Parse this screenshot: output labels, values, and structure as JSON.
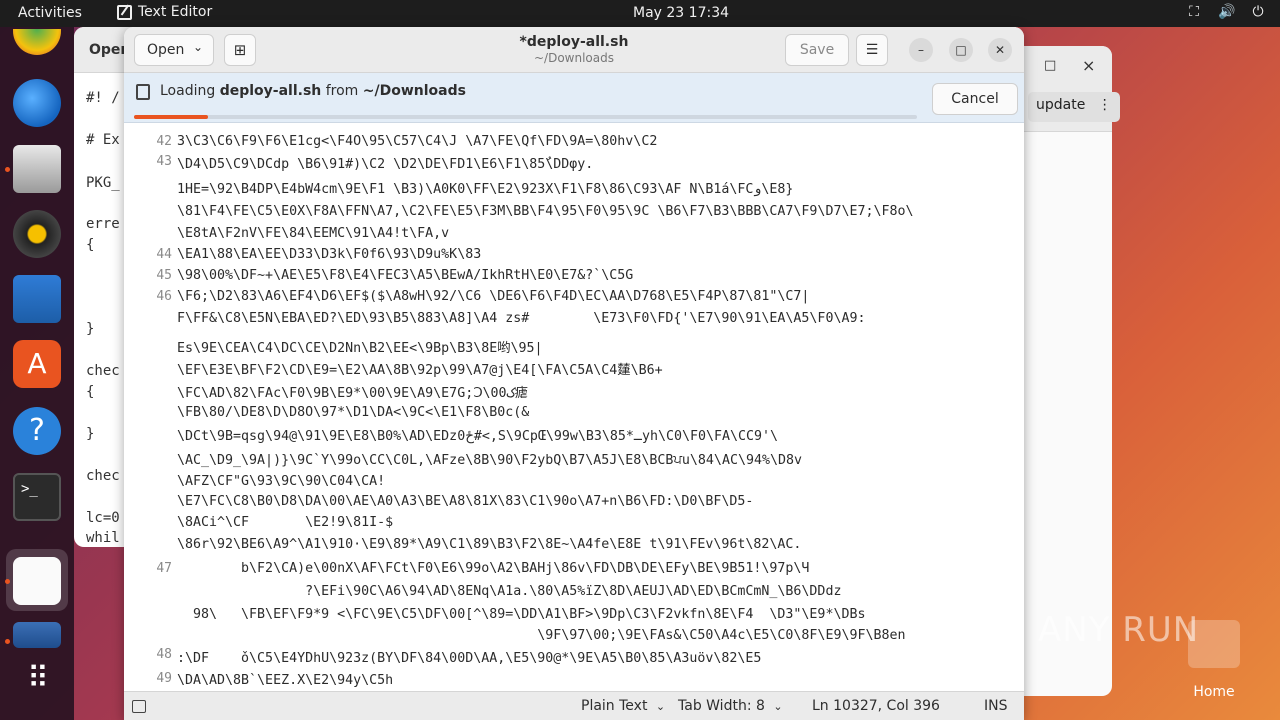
{
  "topbar": {
    "activities": "Activities",
    "app_name": "Text Editor",
    "clock": "May 23  17:34"
  },
  "bg_window": {
    "header": "Open",
    "lines": [
      "#! /",
      "# Ex",
      "PKG_",
      "erre",
      "{",
      "}",
      "chec",
      "{",
      "}",
      "chec",
      "lc=0",
      "whil"
    ]
  },
  "right_window": {
    "update_label": "update",
    "maximize": "□",
    "close": "×"
  },
  "editor": {
    "open_label": "Open",
    "save_label": "Save",
    "title": "*deploy-all.sh",
    "subtitle": "~/Downloads",
    "loading_prefix": "Loading",
    "loading_file": "deploy-all.sh",
    "loading_from": "from",
    "loading_dir": "~/Downloads",
    "cancel_label": "Cancel",
    "progress": 0.095
  },
  "code": {
    "line_numbers": [
      "42",
      "43",
      "44",
      "45",
      "46",
      "47",
      "48",
      "49"
    ],
    "lines": [
      "3\\C3\\C6\\F9\\F6\\E1cg<\\F4O\\95\\C57\\C4\\J \\A7\\FE\\Qf\\FD\\9A=\\80hv\\C2",
      "\\D4\\D5\\C9\\DCdp \\B6\\91#)\\C2 \\D2\\DE\\FD1\\E6\\F1\\85ُ\\DDφy.",
      "1HE=\\92\\B4DP\\E4bW4cm\\9E\\F1 \\B3)\\A0K0\\FF\\E2\\923X\\F1\\F8\\86\\C93\\AF N\\B1á\\FCو\\E8}",
      "\\81\\F4\\FE\\C5\\E0X\\F8A\\FFN\\A7,\\C2\\FE\\E5\\F3M\\BB\\F4\\95\\F0\\95\\9C \\B6\\F7\\B3\\BBB\\CA7\\F9\\D7\\E7;\\F8o\\",
      "\\E8tA\\F2nV\\FE\\84\\EEMC\\91\\A4!t\\FA,v",
      "\\EA1\\88\\EA\\EE\\D33\\D3k\\F0f6\\93\\D9u%K\\83",
      "\\98\\00%\\DF~+\\AE\\E5\\F8\\E4\\FEC3\\A5\\BEwA/IkhRtH\\E0\\E7&?`\\C5G",
      "\\F6;\\D2\\83\\A6\\EF4\\D6\\EF$($\\A8wH\\92/\\C6 \\DE6\\F6\\F4D\\EC\\AA\\D768\\E5\\F4P\\87\\81\"\\C7|",
      "F\\FF&\\C8\\E5N\\EBA\\ED?\\ED\\93\\B5\\883\\A8]\\A4 zs#        \\E73\\F0\\FD{'\\E7\\90\\91\\EA\\A5\\F0\\A9:",
      "Es\\9E\\CEA\\C4\\DC\\CE\\D2Nn\\B2\\EE<\\9Bp\\B3\\8E哟\\95|",
      "\\EF\\E3E\\BF\\F2\\CD\\E9=\\E2\\AA\\8B\\92p\\99\\A7@j\\E4[\\FA\\C5A\\C4㯬\\B6+",
      "\\FC\\AD\\82\\FAc\\F0\\9B\\E9*\\00\\9E\\A9\\E7G;Ↄ\\00ک瘧",
      "\\FB\\80/\\DE8\\D\\D8O\\97*\\D1\\DA<\\9C<\\E1\\F8\\B0c(&",
      "\\DCt\\9B=qsg\\94@\\91\\9E\\E8\\B0%\\AD\\EDzځ0#<,S\\9CpŒ\\99w\\B3\\85*ـyh\\C0\\F0\\FA\\CC9'\\",
      "\\AC_\\D9_\\9A|)}\\9C`Y\\99o\\CC\\C0L,\\AFze\\8B\\90\\F2ybQ\\B7\\A5J\\E8\\BCBਪu\\84\\AC\\94%\\D8v",
      "\\AFZ\\CF\"G\\93\\9C\\90\\C04\\CA!",
      "\\E7\\FC\\C8\\B0\\D8\\DA\\00\\AE\\A0\\A3\\BE\\A8\\81X\\83\\C1\\90o\\A7+n\\B6\\FD:\\D0\\BF\\D5-",
      "\\8ACi^\\CF       \\E2!9\\81I-$",
      "\\86r\\92\\BE6\\A9^\\A1\\910·\\E9\\89*\\A9\\C1\\89\\B3\\F2\\8E~\\A4fe\\E8E t\\91\\FEv\\96t\\82\\AC.",
      "        b\\F2\\CA)e\\00nX\\AF\\FCt\\F0\\E6\\99o\\A2\\BAHj\\86v\\FD\\DB\\DE\\EFy\\BE\\9B51!\\97p\\Ч",
      "                ?\\EFi\\90C\\A6\\94\\AD\\8ENq\\A1a.\\80\\A5%ïZ\\8D\\AEUJ\\AD\\ED\\BCmCmN_\\B6\\DDdz",
      "  98\\   \\FB\\EF\\F9*9 <\\FC\\9E\\C5\\DF\\00[^\\89=\\DD\\A1\\BF>\\9Dp\\C3\\F2vkfn\\8E\\F4  \\D3\"\\E9*\\DBs",
      "                                             \\9F\\97\\00;\\9E\\FAs&\\C50\\A4c\\E5\\C0\\8F\\E9\\9F\\B8en",
      ":\\DF    ǒ\\C5\\E4YDhU\\923z(BY\\DF\\84\\00D\\AA,\\E5\\90@*\\9E\\A5\\B0\\85\\A3uöv\\82\\E5",
      "\\DA\\AD\\8B`\\EEZ.X\\E2\\94y\\C5h"
    ]
  },
  "statusbar": {
    "language": "Plain Text",
    "tab_width": "Tab Width: 8",
    "position": "Ln 10327, Col 396",
    "mode": "INS"
  },
  "desktop": {
    "watermark": "ANY RUN",
    "home_label": "Home"
  },
  "colors": {
    "accent": "#e95420",
    "infobar_bg": "#e3edf7",
    "topbar_bg": "#1d1d1d"
  }
}
